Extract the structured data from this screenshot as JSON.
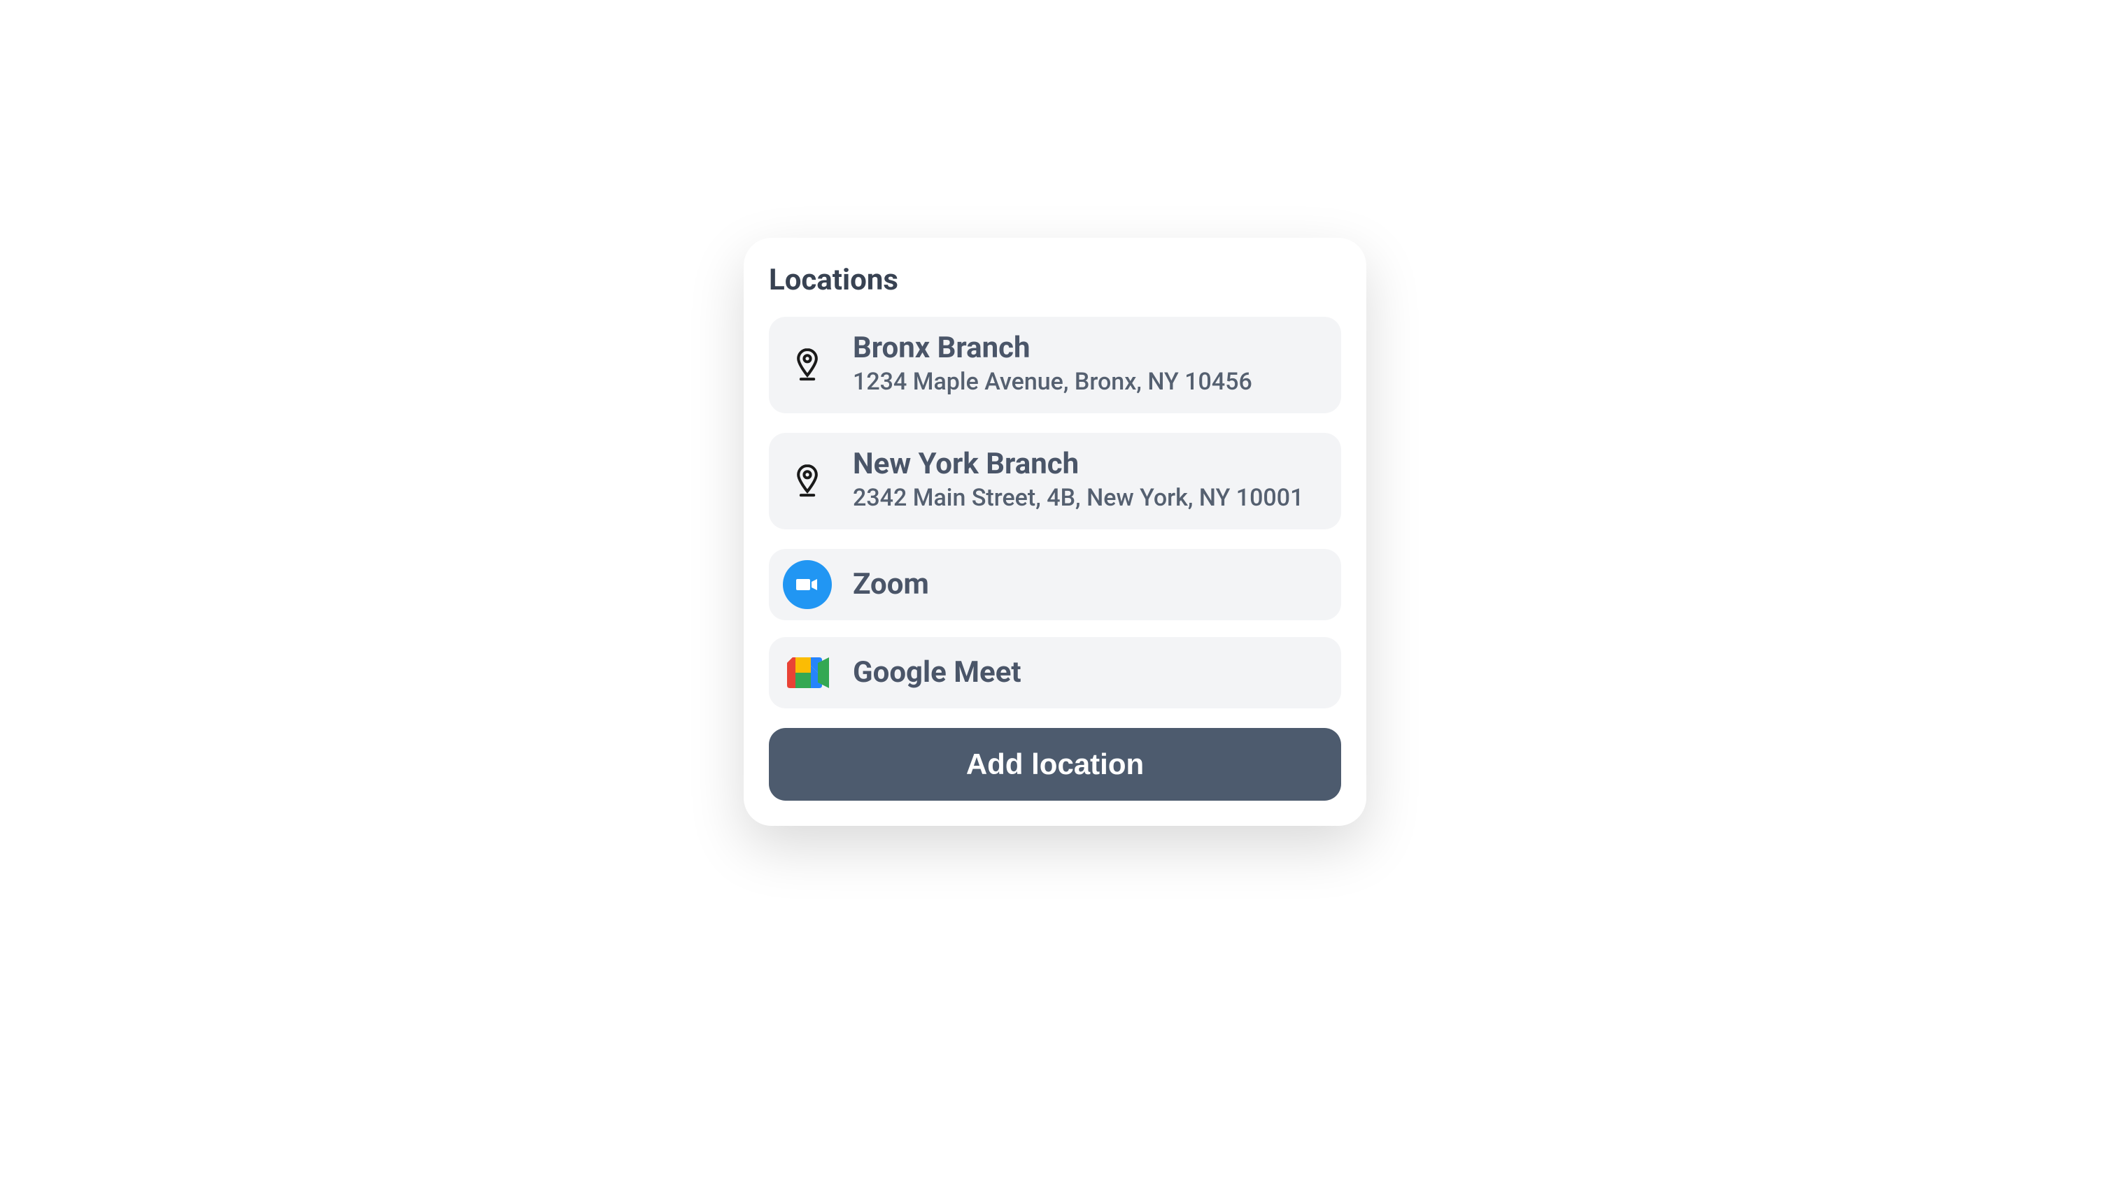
{
  "title": "Locations",
  "locations": [
    {
      "name": "Bronx Branch",
      "address": "1234 Maple Avenue, Bronx, NY 10456",
      "icon": "map-pin"
    },
    {
      "name": "New York Branch",
      "address": "2342 Main Street, 4B, New York, NY 10001",
      "icon": "map-pin"
    },
    {
      "name": "Zoom",
      "icon": "zoom"
    },
    {
      "name": "Google Meet",
      "icon": "google-meet"
    }
  ],
  "addButton": "Add location"
}
